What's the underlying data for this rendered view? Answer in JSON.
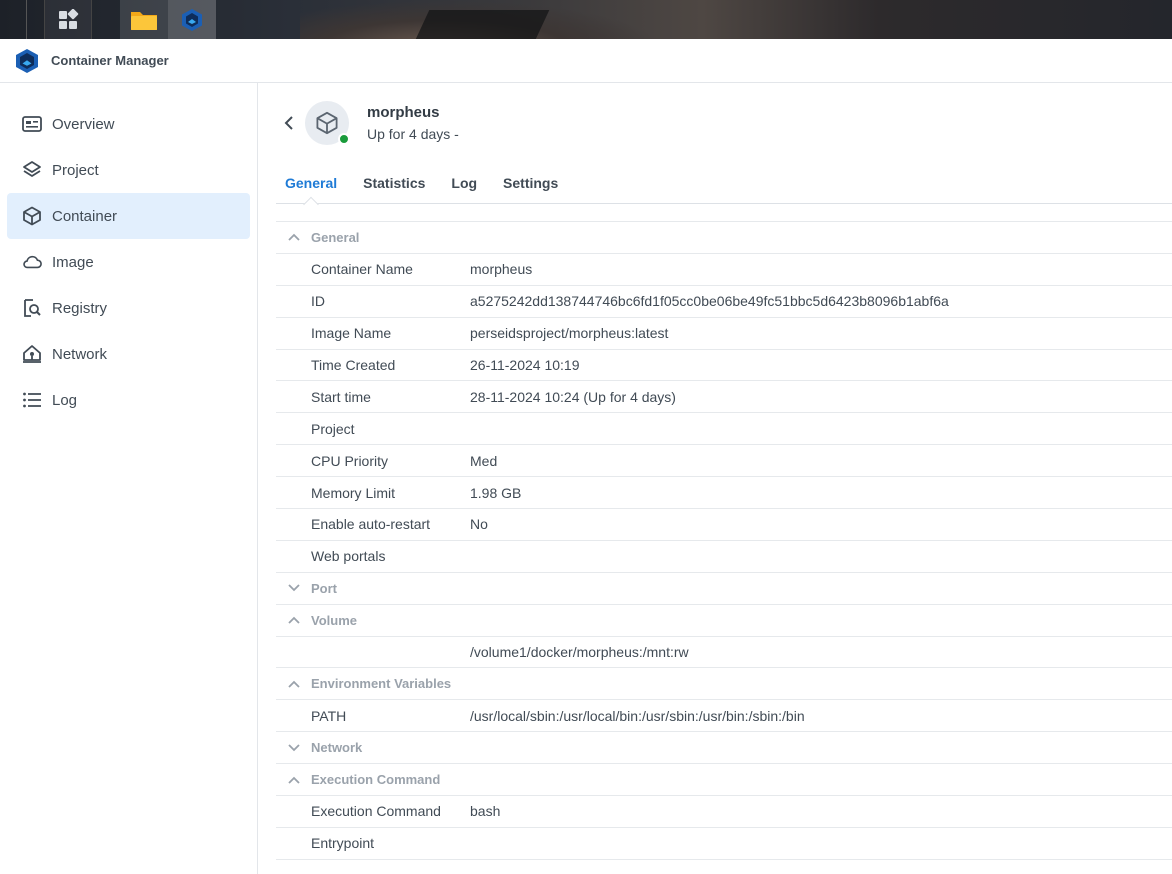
{
  "app": {
    "title": "Container Manager"
  },
  "sidebar": {
    "items": [
      {
        "label": "Overview",
        "icon": "dashboard-icon",
        "active": false
      },
      {
        "label": "Project",
        "icon": "layers-icon",
        "active": false
      },
      {
        "label": "Container",
        "icon": "cube-icon",
        "active": true
      },
      {
        "label": "Image",
        "icon": "cloud-icon",
        "active": false
      },
      {
        "label": "Registry",
        "icon": "registry-search-icon",
        "active": false
      },
      {
        "label": "Network",
        "icon": "network-home-icon",
        "active": false
      },
      {
        "label": "Log",
        "icon": "list-icon",
        "active": false
      }
    ]
  },
  "container": {
    "name": "morpheus",
    "status": "Up for 4 days -",
    "status_color": "#1a9b3b"
  },
  "tabs": [
    {
      "label": "General",
      "active": true
    },
    {
      "label": "Statistics",
      "active": false
    },
    {
      "label": "Log",
      "active": false
    },
    {
      "label": "Settings",
      "active": false
    }
  ],
  "sections": {
    "general": {
      "title": "General",
      "expanded": true,
      "rows": [
        {
          "key": "Container Name",
          "value": "morpheus"
        },
        {
          "key": "ID",
          "value": "a5275242dd138744746bc6fd1f05cc0be06be49fc51bbc5d6423b8096b1abf6a"
        },
        {
          "key": "Image Name",
          "value": "perseidsproject/morpheus:latest"
        },
        {
          "key": "Time Created",
          "value": "26-11-2024 10:19"
        },
        {
          "key": "Start time",
          "value": "28-11-2024 10:24 (Up for 4 days)"
        },
        {
          "key": "Project",
          "value": ""
        },
        {
          "key": "CPU Priority",
          "value": "Med"
        },
        {
          "key": "Memory Limit",
          "value": "1.98 GB"
        },
        {
          "key": "Enable auto-restart",
          "value": "No"
        },
        {
          "key": "Web portals",
          "value": ""
        }
      ]
    },
    "port": {
      "title": "Port",
      "expanded": false
    },
    "volume": {
      "title": "Volume",
      "expanded": true,
      "rows": [
        {
          "key": "",
          "value": "/volume1/docker/morpheus:/mnt:rw"
        }
      ]
    },
    "env": {
      "title": "Environment Variables",
      "expanded": true,
      "rows": [
        {
          "key": "PATH",
          "value": "/usr/local/sbin:/usr/local/bin:/usr/sbin:/usr/bin:/sbin:/bin"
        }
      ]
    },
    "network": {
      "title": "Network",
      "expanded": false
    },
    "exec": {
      "title": "Execution Command",
      "expanded": true,
      "rows": [
        {
          "key": "Execution Command",
          "value": "bash"
        },
        {
          "key": "Entrypoint",
          "value": ""
        }
      ]
    }
  },
  "colors": {
    "accent": "#1f7bd6",
    "active_bg": "#e2effd"
  }
}
